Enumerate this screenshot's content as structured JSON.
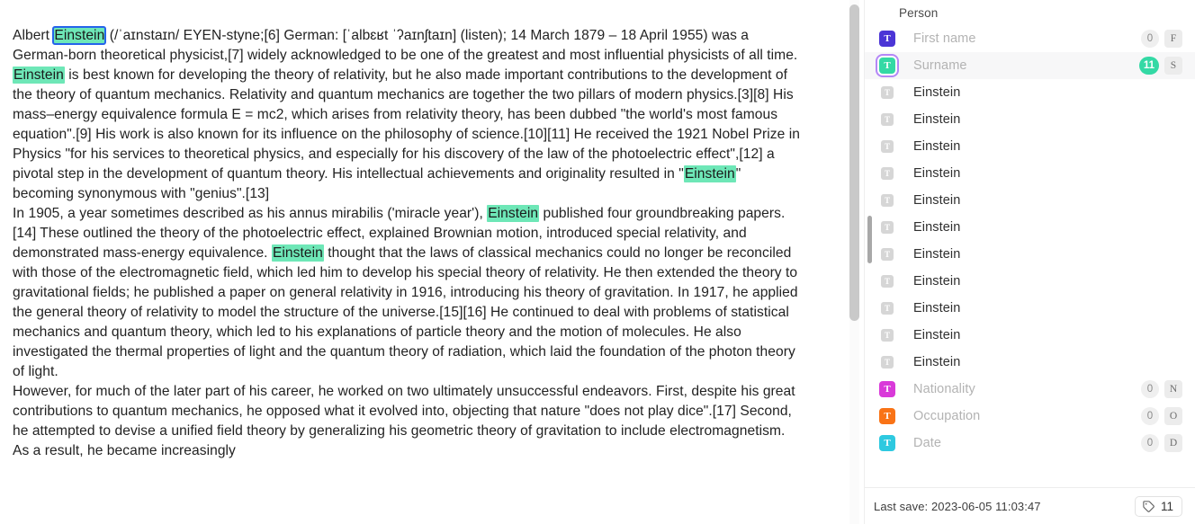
{
  "document": {
    "paragraphs": [
      {
        "id": "p1",
        "segments": [
          {
            "t": "Albert "
          },
          {
            "t": "Einstein",
            "hl": true,
            "selected": true
          },
          {
            "t": " (/ˈaɪnstaɪn/ EYEN-styne;[6] German: [ˈalbɛʁt ˈʔaɪnʃtaɪn] (listen); 14 March 1879 – 18 April 1955) was a German-born theoretical physicist,[7] widely acknowledged to be one of the greatest and most influential physicists of all time. "
          },
          {
            "t": "Einstein",
            "hl": true
          },
          {
            "t": " is best known for developing the theory of relativity, but he also made important contributions to the development of the theory of quantum mechanics. Relativity and quantum mechanics are together the two pillars of modern physics.[3][8] His mass–energy equivalence formula E = mc2, which arises from relativity theory, has been dubbed \"the world's most famous equation\".[9] His work is also known for its influence on the philosophy of science.[10][11] He received the 1921 Nobel Prize in Physics \"for his services to theoretical physics, and especially for his discovery of the law of the photoelectric effect\",[12] a pivotal step in the development of quantum theory. His intellectual achievements and originality resulted in \""
          },
          {
            "t": "Einstein",
            "hl": true
          },
          {
            "t": "\" becoming synonymous with \"genius\".[13]"
          }
        ]
      },
      {
        "id": "p2",
        "segments": [
          {
            "t": "In 1905, a year sometimes described as his annus mirabilis ('miracle year'), "
          },
          {
            "t": "Einstein",
            "hl": true
          },
          {
            "t": " published four groundbreaking papers.[14] These outlined the theory of the photoelectric effect, explained Brownian motion, introduced special relativity, and demonstrated mass-energy equivalence. "
          },
          {
            "t": "Einstein",
            "hl": true
          },
          {
            "t": " thought that the laws of classical mechanics could no longer be reconciled with those of the electromagnetic field, which led him to develop his special theory of relativity. He then extended the theory to gravitational fields; he published a paper on general relativity in 1916, introducing his theory of gravitation. In 1917, he applied the general theory of relativity to model the structure of the universe.[15][16] He continued to deal with problems of statistical mechanics and quantum theory, which led to his explanations of particle theory and the motion of molecules. He also investigated the thermal properties of light and the quantum theory of radiation, which laid the foundation of the photon theory of light."
          }
        ]
      },
      {
        "id": "p3",
        "segments": [
          {
            "t": "However, for much of the later part of his career, he worked on two ultimately unsuccessful endeavors. First, despite his great contributions to quantum mechanics, he opposed what it evolved into, objecting that nature \"does not play dice\".[17] Second, he attempted to devise a unified field theory by generalizing his geometric theory of gravitation to include electromagnetism. As a result, he became increasingly"
          }
        ]
      }
    ]
  },
  "sidebar": {
    "group_title": "Person",
    "rows": [
      {
        "kind": "schema",
        "icon_glyph": "T",
        "icon_color": "#4b35d6",
        "label": "First name",
        "count": "0",
        "count_active": false,
        "key": "F",
        "selected": false
      },
      {
        "kind": "schema",
        "icon_glyph": "T",
        "icon_color": "#34d9a5",
        "label": "Surname",
        "count": "11",
        "count_active": true,
        "key": "S",
        "selected": true
      },
      {
        "kind": "value",
        "icon_glyph": "T",
        "label": "Einstein"
      },
      {
        "kind": "value",
        "icon_glyph": "T",
        "label": "Einstein"
      },
      {
        "kind": "value",
        "icon_glyph": "T",
        "label": "Einstein"
      },
      {
        "kind": "value",
        "icon_glyph": "T",
        "label": "Einstein"
      },
      {
        "kind": "value",
        "icon_glyph": "T",
        "label": "Einstein"
      },
      {
        "kind": "value",
        "icon_glyph": "T",
        "label": "Einstein"
      },
      {
        "kind": "value",
        "icon_glyph": "T",
        "label": "Einstein"
      },
      {
        "kind": "value",
        "icon_glyph": "T",
        "label": "Einstein"
      },
      {
        "kind": "value",
        "icon_glyph": "T",
        "label": "Einstein"
      },
      {
        "kind": "value",
        "icon_glyph": "T",
        "label": "Einstein"
      },
      {
        "kind": "value",
        "icon_glyph": "T",
        "label": "Einstein"
      },
      {
        "kind": "schema",
        "icon_glyph": "T",
        "icon_color": "#d93ad9",
        "label": "Nationality",
        "count": "0",
        "count_active": false,
        "key": "N",
        "selected": false
      },
      {
        "kind": "schema",
        "icon_glyph": "T",
        "icon_color": "#f97316",
        "label": "Occupation",
        "count": "0",
        "count_active": false,
        "key": "O",
        "selected": false
      },
      {
        "kind": "schema",
        "icon_glyph": "T",
        "icon_color": "#2ec9e0",
        "label": "Date",
        "count": "0",
        "count_active": false,
        "key": "D",
        "selected": false
      }
    ],
    "footer": {
      "last_save": "Last save: 2023-06-05 11:03:47",
      "tag_count": "11",
      "tag_icon": "tag-icon"
    }
  },
  "colors": {
    "highlight": "#6ee7b7",
    "selection_outline": "#2563eb",
    "accent_active": "#34d9a5",
    "focus_ring": "#b487f7"
  }
}
